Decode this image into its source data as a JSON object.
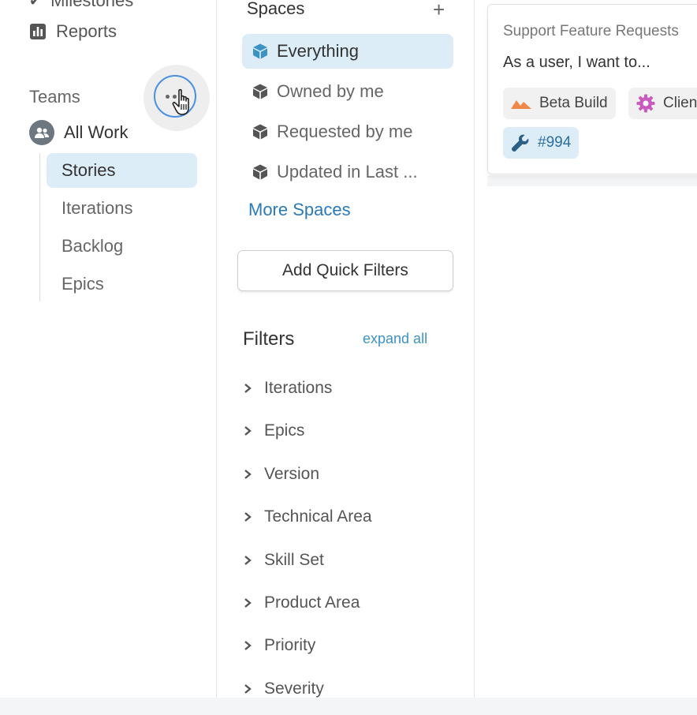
{
  "left_nav": {
    "cut_item_label": "Milestones",
    "reports_label": "Reports",
    "teams_label": "Teams",
    "team_name": "All Work",
    "team_items": [
      {
        "label": "Stories",
        "active": true
      },
      {
        "label": "Iterations",
        "active": false
      },
      {
        "label": "Backlog",
        "active": false
      },
      {
        "label": "Epics",
        "active": false
      }
    ]
  },
  "spaces": {
    "title": "Spaces",
    "add_symbol": "+",
    "items": [
      {
        "label": "Everything",
        "active": true
      },
      {
        "label": "Owned by me",
        "active": false
      },
      {
        "label": "Requested by me",
        "active": false
      },
      {
        "label": "Updated in Last ...",
        "active": false
      }
    ],
    "more_link": "More Spaces",
    "quick_filters_button": "Add Quick Filters"
  },
  "filters": {
    "title": "Filters",
    "expand_all": "expand all",
    "items": [
      "Iterations",
      "Epics",
      "Version",
      "Technical Area",
      "Skill Set",
      "Product Area",
      "Priority",
      "Severity"
    ]
  },
  "story_card": {
    "project": "Support Feature Requests",
    "title": "As a user, I want to...",
    "chips": {
      "beta": "Beta Build",
      "client": "Client",
      "number": "#994"
    }
  },
  "colors": {
    "accent_blue": "#2b7ab8",
    "active_bg": "#dcedf8",
    "cube_active": "#3b93c4",
    "cube_inactive": "#555555",
    "beta_icon": "#f0884a",
    "gear_icon": "#c95bbf",
    "wrench_icon": "#2b5f85"
  }
}
